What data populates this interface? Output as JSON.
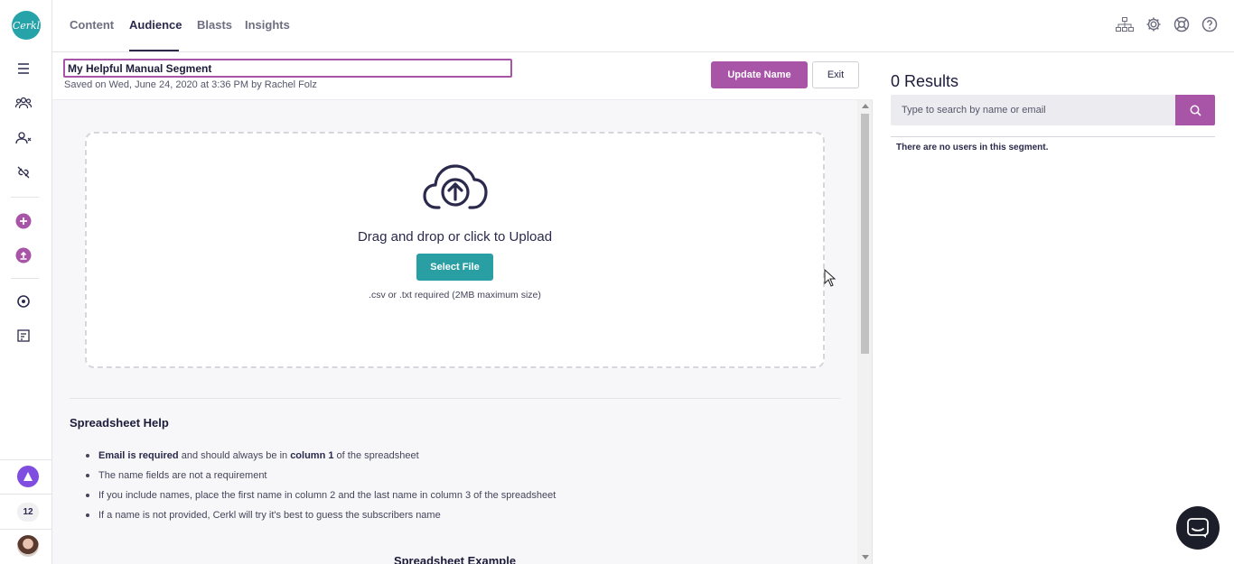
{
  "brand": {
    "logo_text": "Cerkl",
    "logo_color": "#26a3a8",
    "accent_color": "#a855a8",
    "teal_color": "#2a9fa3"
  },
  "topnav": {
    "tabs": [
      {
        "label": "Content"
      },
      {
        "label": "Audience",
        "active": true
      },
      {
        "label": "Blasts"
      },
      {
        "label": "Insights"
      }
    ],
    "icons": [
      "sitemap-icon",
      "gear-icon",
      "lifebuoy-icon",
      "help-icon"
    ]
  },
  "sidebar": {
    "icons": [
      "menu-icon",
      "users-icon",
      "user-remove-icon",
      "unlink-icon",
      "add-circle-icon",
      "upload-circle-icon",
      "target-icon",
      "calendar-list-icon"
    ],
    "notification_count": "12"
  },
  "segment": {
    "name": "My Helpful Manual Segment",
    "saved_text": "Saved on Wed, June 24, 2020 at 3:36 PM by Rachel Folz",
    "update_label": "Update Name",
    "exit_label": "Exit"
  },
  "upload": {
    "drop_text": "Drag and drop or click to Upload",
    "select_label": "Select File",
    "requirement": ".csv or .txt required (2MB maximum size)"
  },
  "help": {
    "title": "Spreadsheet Help",
    "item1_bold1": "Email is required",
    "item1_mid": " and should always be in ",
    "item1_bold2": "column 1",
    "item1_end": " of the spreadsheet",
    "item2": "The name fields are not a requirement",
    "item3": "If you include names, place the first name in column 2 and the last name in column 3 of the spreadsheet",
    "item4": "If a name is not provided, Cerkl will try it's best to guess the subscribers name",
    "example_title": "Spreadsheet Example"
  },
  "results": {
    "title": "0 Results",
    "search_placeholder": "Type to search by name or email",
    "empty_text": "There are no users in this segment."
  }
}
